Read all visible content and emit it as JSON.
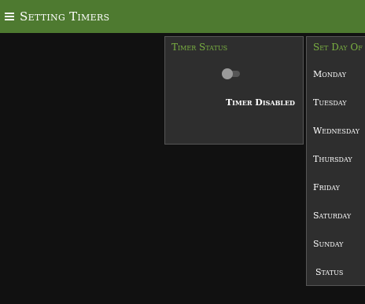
{
  "header": {
    "title": "Setting Timers",
    "menu_icon": "hamburger-menu-icon",
    "background": "#4e7a30"
  },
  "timer_status": {
    "title": "Timer Status",
    "toggle_state": "off",
    "status_text": "Timer Disabled"
  },
  "days_panel": {
    "title": "Set Day Of Week",
    "days": [
      "Monday",
      "Tuesday",
      "Wednesday",
      "Thursday",
      "Friday",
      "Saturday",
      "Sunday"
    ],
    "status_label": "Status"
  },
  "colors": {
    "accent": "#7cb342",
    "panel": "#2e2e2e",
    "background": "#111111"
  }
}
